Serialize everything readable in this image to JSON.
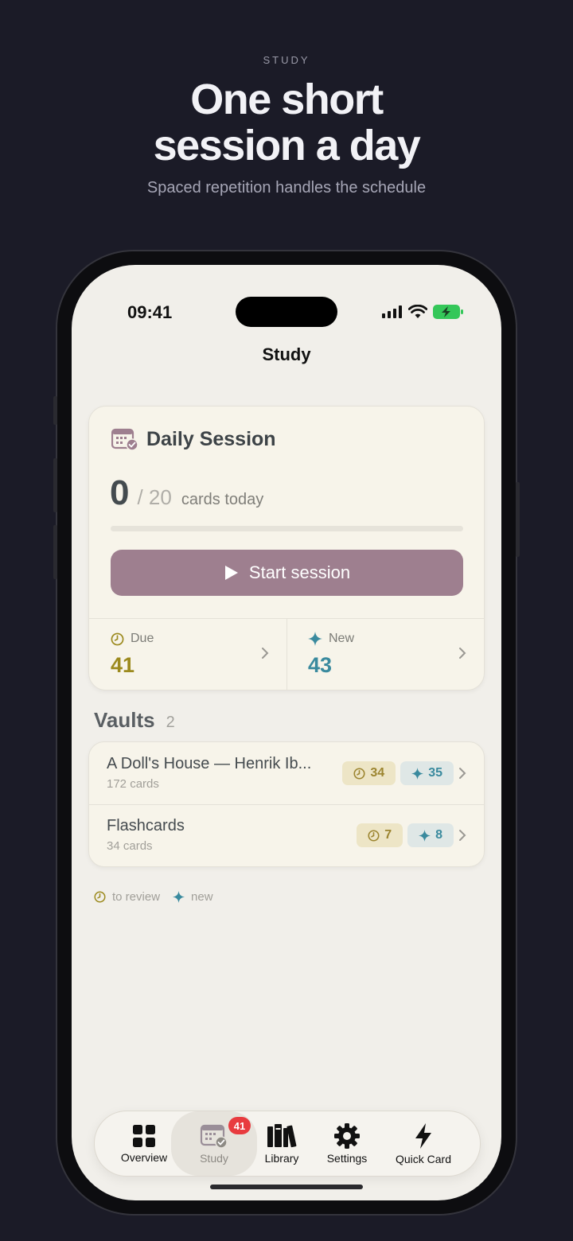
{
  "promo": {
    "eyebrow": "STUDY",
    "title_line1": "One short",
    "title_line2": "session a day",
    "subtitle": "Spaced repetition handles the schedule"
  },
  "status_bar": {
    "time": "09:41"
  },
  "nav": {
    "title": "Study"
  },
  "daily_session": {
    "title": "Daily Session",
    "done": "0",
    "goal": "/ 20",
    "label": "cards today",
    "progress": 0,
    "start_label": "Start session",
    "due": {
      "label": "Due",
      "value": "41",
      "color": "#9c8a1e"
    },
    "new": {
      "label": "New",
      "value": "43",
      "color": "#3a8a9e"
    }
  },
  "vaults": {
    "title": "Vaults",
    "count": "2",
    "items": [
      {
        "name": "A Doll's House — Henrik Ib...",
        "cards": "172 cards",
        "due": "34",
        "new": "35"
      },
      {
        "name": "Flashcards",
        "cards": "34 cards",
        "due": "7",
        "new": "8"
      }
    ],
    "legend": {
      "review": "to review",
      "new": "new"
    }
  },
  "tabbar": {
    "items": [
      {
        "label": "Overview",
        "icon": "grid-icon"
      },
      {
        "label": "Study",
        "icon": "calendar-check-icon",
        "badge": "41",
        "active": true
      },
      {
        "label": "Library",
        "icon": "books-icon"
      },
      {
        "label": "Settings",
        "icon": "gear-icon"
      },
      {
        "label": "Quick Card",
        "icon": "bolt-icon"
      }
    ]
  },
  "colors": {
    "accent": "#9e7f8f",
    "due": "#9c8a1e",
    "new": "#3a8a9e",
    "badge": "#e83b3f"
  }
}
